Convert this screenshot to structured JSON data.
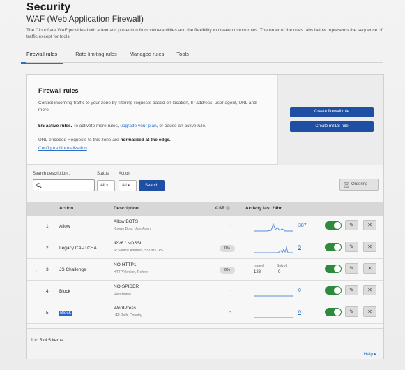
{
  "header": {
    "title": "Security",
    "subtitle": "WAF (Web Application Firewall)",
    "description": "The Cloudflare WAF provides both automatic protection from vulnerabilities and the flexibility to create custom rules. The order of the rules tabs below represents the sequence of traffic except for tools."
  },
  "tabs": [
    {
      "label": "Firewall rules",
      "active": true
    },
    {
      "label": "Rate limiting rules",
      "active": false
    },
    {
      "label": "Managed rules",
      "active": false
    },
    {
      "label": "Tools",
      "active": false
    }
  ],
  "firewall": {
    "title": "Firewall rules",
    "text": "Control incoming traffic to your zone by filtering requests based on location, IP address, user agent, URL and more.",
    "active_bold": "5/5 active rules.",
    "active_text": " To activate more rules, ",
    "upgrade_link": "upgrade your plan",
    "active_tail": ", or pause an active rule.",
    "norm_text": "URL-encoded Requests to this zone are ",
    "norm_bold": "normalized at the edge.",
    "norm_link": "Configure Normalization",
    "create_rule": "Create firewall rule",
    "create_mtls": "Create mTLS rule"
  },
  "filters": {
    "search_label": "Search description...",
    "search_value": "",
    "status_label": "Status",
    "status_value": "All",
    "action_label": "Action",
    "action_value": "All",
    "search_button": "Search",
    "ordering_button": "Ordering"
  },
  "table": {
    "headers": {
      "action": "Action",
      "description": "Description",
      "csr": "CSR",
      "activity": "Activity last 24hr"
    },
    "rows": [
      {
        "num": "1",
        "action": "Allow",
        "desc": "Allow BOTS",
        "sub": "Known Bots, User Agent",
        "csr": "-",
        "count": "387",
        "spark": "peak"
      },
      {
        "num": "2",
        "action": "Legacy CAPTCHA",
        "desc": "IPV6 / NOSSL",
        "sub": "IP Source Address, SSL/HTTPS",
        "csr": "0%",
        "count": "5",
        "spark": "end"
      },
      {
        "num": "3",
        "action": "JS Challenge",
        "desc": "NO-HTTP1",
        "sub": "HTTP Version, Referer",
        "csr": "0%",
        "issued_label": "Issued",
        "issued": "128",
        "solved_label": "Solved",
        "solved": "0"
      },
      {
        "num": "4",
        "action": "Block",
        "desc": "NO-SPIDER",
        "sub": "User Agent",
        "csr": "-",
        "count": "0",
        "spark": "flat"
      },
      {
        "num": "5",
        "action": "Block",
        "desc": "WordPress",
        "sub": "URI Path, Country",
        "csr": "-",
        "count": "0",
        "spark": "flat"
      }
    ]
  },
  "footer": {
    "items": "1 to 5 of 5 items",
    "help": "Help ▸"
  },
  "colors": {
    "primary": "#1f4fa3",
    "toggle_on": "#2f8a3e",
    "link": "#2a6fc7"
  }
}
